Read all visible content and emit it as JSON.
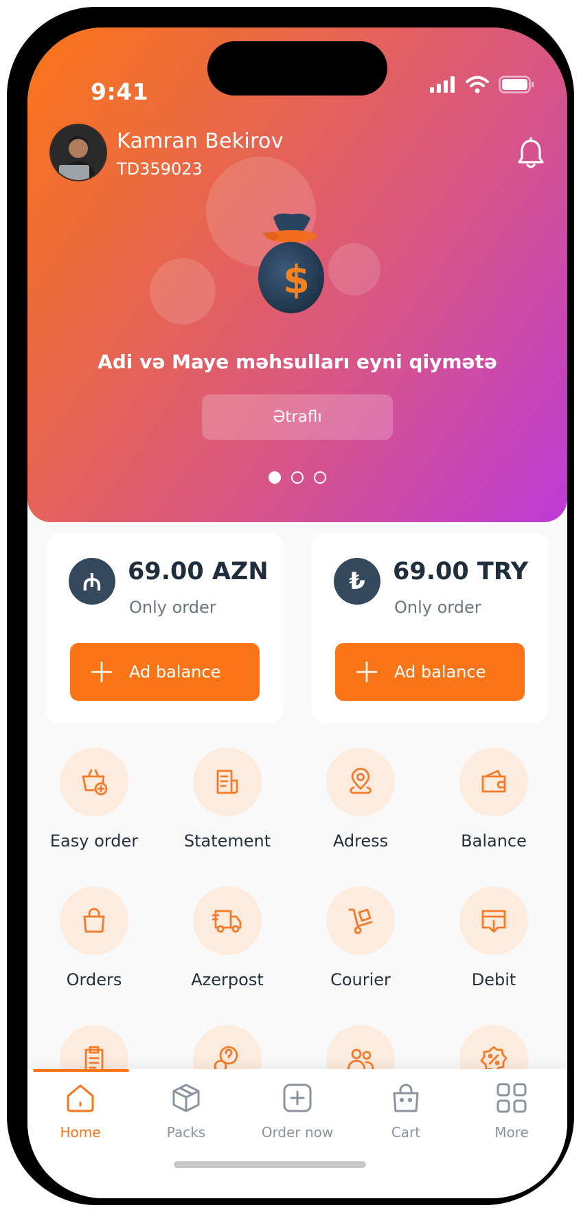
{
  "status_bar": {
    "time": "9:41"
  },
  "user": {
    "name": "Kamran Bekirov",
    "id": "TD359023"
  },
  "promo": {
    "text": "Adi və Maye məhsulları eyni qiymətə",
    "button": "Ətraflı",
    "slide_count": 3,
    "active_slide": 1
  },
  "balances": [
    {
      "currency_symbol": "₼",
      "amount": "69.00 AZN",
      "subtitle": "Only order",
      "button": "Ad balance"
    },
    {
      "currency_symbol": "₺",
      "amount": "69.00 TRY",
      "subtitle": "Only order",
      "button": "Ad balance"
    }
  ],
  "services": [
    {
      "label": "Easy order",
      "icon": "basket-plus-icon"
    },
    {
      "label": "Statement",
      "icon": "document-icon"
    },
    {
      "label": "Adress",
      "icon": "location-pin-icon"
    },
    {
      "label": "Balance",
      "icon": "wallet-icon"
    },
    {
      "label": "Orders",
      "icon": "bag-icon"
    },
    {
      "label": "Azerpost",
      "icon": "truck-icon"
    },
    {
      "label": "Courier",
      "icon": "hand-truck-icon"
    },
    {
      "label": "Debit",
      "icon": "card-download-icon"
    },
    {
      "label": "",
      "icon": "clipboard-icon"
    },
    {
      "label": "",
      "icon": "question-chat-icon"
    },
    {
      "label": "",
      "icon": "users-icon"
    },
    {
      "label": "",
      "icon": "discount-badge-icon"
    }
  ],
  "tabs": [
    {
      "label": "Home",
      "icon": "home-icon",
      "active": true
    },
    {
      "label": "Packs",
      "icon": "box-icon",
      "active": false
    },
    {
      "label": "Order now",
      "icon": "plus-square-icon",
      "active": false
    },
    {
      "label": "Cart",
      "icon": "shopping-bag-icon",
      "active": false
    },
    {
      "label": "More",
      "icon": "grid-icon",
      "active": false
    }
  ],
  "colors": {
    "accent": "#fb7416",
    "gradient_start": "#fb7418",
    "gradient_end": "#bd3ad7",
    "icon_bg": "#fdebdd",
    "dark": "#35495e"
  }
}
